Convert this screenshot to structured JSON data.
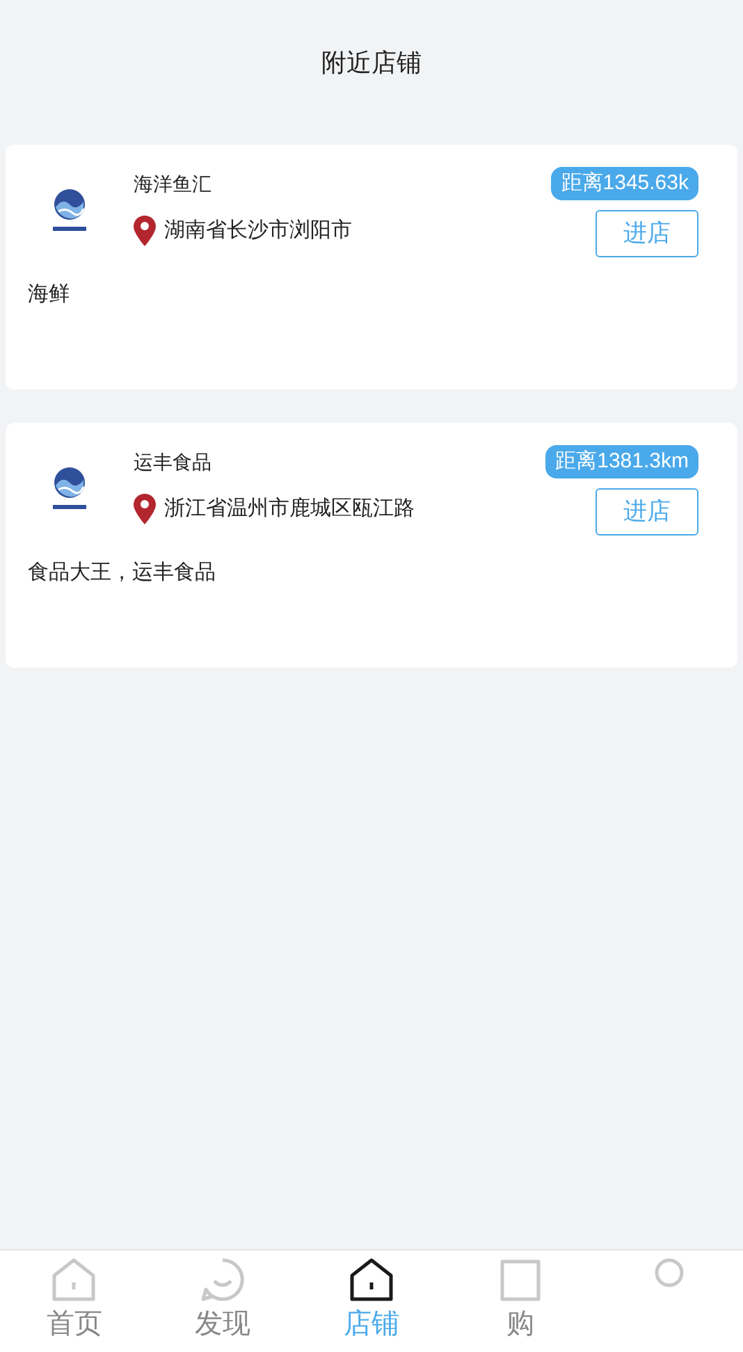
{
  "header": {
    "title": "附近店铺"
  },
  "stores": [
    {
      "name": "海洋鱼汇",
      "address": "湖南省长沙市浏阳市",
      "distance": "距离1345.63k",
      "enter": "进店",
      "description": "海鲜"
    },
    {
      "name": "运丰食品",
      "address": "浙江省温州市鹿城区瓯江路",
      "distance": "距离1381.3km",
      "enter": "进店",
      "description": "食品大王，运丰食品"
    }
  ],
  "tabbar": [
    {
      "kind": "home",
      "label": "首页",
      "selected": false
    },
    {
      "kind": "discover",
      "label": "发现",
      "selected": false
    },
    {
      "kind": "store",
      "label": "店铺",
      "selected": true
    },
    {
      "kind": "cart",
      "label": "购",
      "selected": false
    },
    {
      "kind": "me",
      "selected": false
    }
  ]
}
